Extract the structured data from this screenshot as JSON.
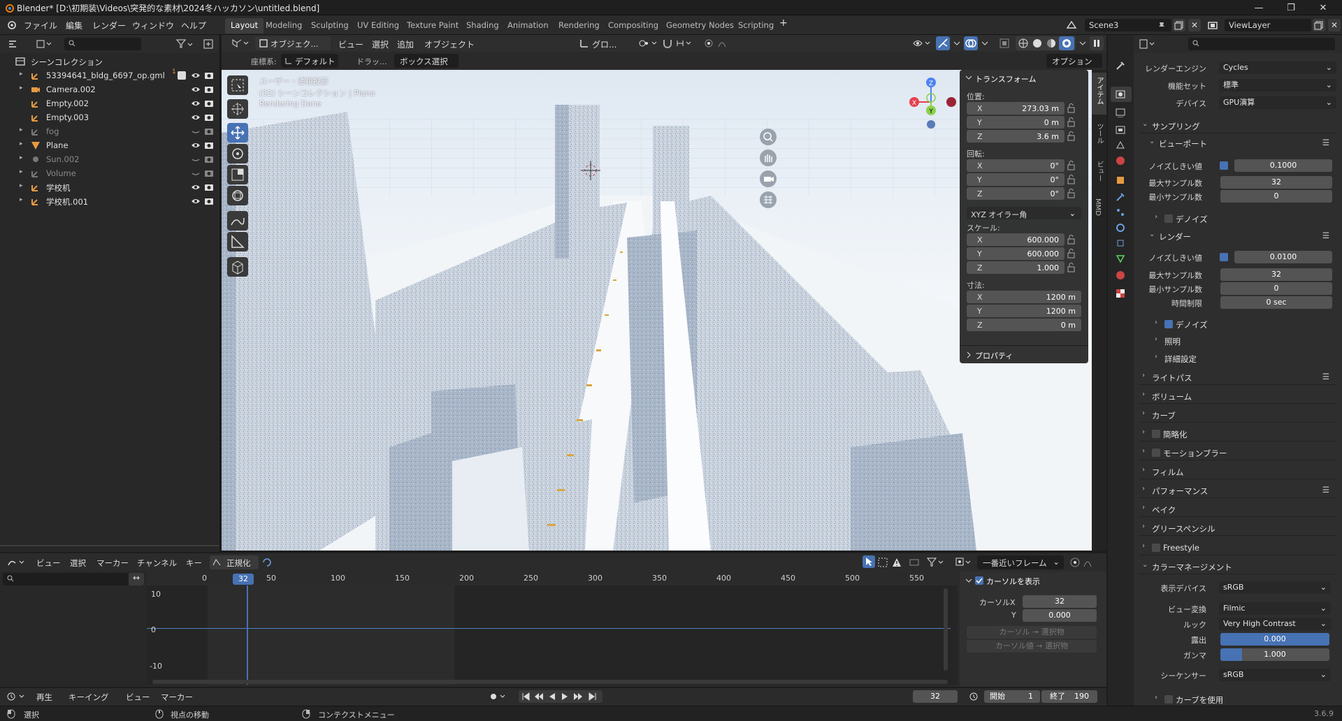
{
  "window": {
    "title": "Blender* [D:\\初期装\\Videos\\突発的な素材\\2024冬ハッカソン\\untitled.blend]"
  },
  "menu": [
    "ファイル",
    "編集",
    "レンダー",
    "ウィンドウ",
    "ヘルプ"
  ],
  "workspace_tabs": [
    {
      "label": "Layout",
      "active": true
    },
    {
      "label": "Modeling"
    },
    {
      "label": "Sculpting"
    },
    {
      "label": "UV Editing"
    },
    {
      "label": "Texture Paint"
    },
    {
      "label": "Shading"
    },
    {
      "label": "Animation"
    },
    {
      "label": "Rendering"
    },
    {
      "label": "Compositing"
    },
    {
      "label": "Geometry Nodes"
    },
    {
      "label": "Scripting"
    }
  ],
  "add_workspace": "+",
  "scene": "Scene3",
  "view_layer": "ViewLayer",
  "outliner": {
    "root": "シーンコレクション",
    "items": [
      {
        "label": "53394641_bldg_6697_op.gml",
        "badge": "1",
        "dim": false
      },
      {
        "label": "Camera.002",
        "dim": false
      },
      {
        "label": "Empty.002",
        "dim": false
      },
      {
        "label": "Empty.003",
        "dim": false
      },
      {
        "label": "fog",
        "dim": true
      },
      {
        "label": "Plane",
        "dim": false
      },
      {
        "label": "Sun.002",
        "dim": true
      },
      {
        "label": "Volume",
        "dim": true
      },
      {
        "label": "学校机",
        "dim": false
      },
      {
        "label": "学校机.001",
        "dim": false
      }
    ]
  },
  "viewport_header": {
    "mode": "オブジェク...",
    "menus": [
      "ビュー",
      "選択",
      "追加",
      "オブジェクト"
    ],
    "transform_orientation": "グロ...",
    "coord_label": "座標系:",
    "coord_value": "デフォルト",
    "drag_label": "ドラッ...",
    "select_mode": "ボックス選択",
    "options": "オプション"
  },
  "viewport_overlay": {
    "line1": "ユーザー・透視投影",
    "line2": "(32) シーンコレクション | Plane",
    "line3": "Rendering Done"
  },
  "gizmo": {
    "x": "X",
    "y": "Y",
    "z": "Z"
  },
  "npanel": {
    "transform_title": "トランスフォーム",
    "location_label": "位置:",
    "location": [
      {
        "k": "X",
        "v": "273.03 m"
      },
      {
        "k": "Y",
        "v": "0 m"
      },
      {
        "k": "Z",
        "v": "3.6 m"
      }
    ],
    "rotation_label": "回転:",
    "rotation": [
      {
        "k": "X",
        "v": "0°"
      },
      {
        "k": "Y",
        "v": "0°"
      },
      {
        "k": "Z",
        "v": "0°"
      }
    ],
    "rotation_mode": "XYZ オイラー角",
    "scale_label": "スケール:",
    "scale": [
      {
        "k": "X",
        "v": "600.000"
      },
      {
        "k": "Y",
        "v": "600.000"
      },
      {
        "k": "Z",
        "v": "1.000"
      }
    ],
    "dimensions_label": "寸法:",
    "dimensions": [
      {
        "k": "X",
        "v": "1200 m"
      },
      {
        "k": "Y",
        "v": "1200 m"
      },
      {
        "k": "Z",
        "v": "0 m"
      }
    ],
    "properties_title": "プロパティ",
    "side_tabs": [
      "アイテム",
      "ツール",
      "ビュー",
      "MMD"
    ]
  },
  "properties": {
    "render_engine_label": "レンダーエンジン",
    "render_engine": "Cycles",
    "feature_set_label": "機能セット",
    "feature_set": "標準",
    "device_label": "デバイス",
    "device": "GPU演算",
    "sampling": "サンプリング",
    "viewport": "ビューポート",
    "noise_threshold_label": "ノイズしきい値",
    "vp_noise": "0.1000",
    "max_samples_label": "最大サンプル数",
    "vp_max": "32",
    "min_samples_label": "最小サンプル数",
    "vp_min": "0",
    "denoise": "デノイズ",
    "render": "レンダー",
    "r_noise": "0.0100",
    "r_max": "32",
    "r_min": "0",
    "time_limit_label": "時間制限",
    "time_limit": "0 sec",
    "denoise2": "デノイズ",
    "lighting": "照明",
    "advanced": "詳細設定",
    "sections": [
      "ライトパス",
      "ボリューム",
      "カーブ",
      "簡略化",
      "モーションブラー",
      "フィルム",
      "パフォーマンス",
      "ベイク",
      "グリースペンシル",
      "Freestyle",
      "カラーマネージメント"
    ],
    "display_device_label": "表示デバイス",
    "display_device": "sRGB",
    "view_transform_label": "ビュー変換",
    "view_transform": "Filmic",
    "look_label": "ルック",
    "look": "Very High Contrast",
    "exposure_label": "露出",
    "exposure": "0.000",
    "gamma_label": "ガンマ",
    "gamma": "1.000",
    "gamma_value": 1.0,
    "sequencer_label": "シーケンサー",
    "sequencer": "sRGB",
    "use_curves": "カーブを使用"
  },
  "graph_editor": {
    "menus": [
      "ビュー",
      "選択",
      "マーカー",
      "チャンネル",
      "キー"
    ],
    "normalize": "正規化",
    "snap": "一番近いフレーム",
    "ticks": [
      "0",
      "50",
      "100",
      "150",
      "200",
      "250",
      "300",
      "350",
      "400",
      "450",
      "500",
      "550"
    ],
    "current_frame": "32",
    "y_labels": [
      "10",
      "0",
      "-10"
    ],
    "cursor_title": "カーソルを表示",
    "cursor_x_label": "カーソルX",
    "cursor_x": "32",
    "cursor_y_label": "Y",
    "cursor_y": "0.000",
    "btn1": "カーソル → 選択物",
    "btn2": "カーソル値 → 選択物"
  },
  "timeline": {
    "menus": [
      "再生",
      "キーイング",
      "ビュー",
      "マーカー"
    ],
    "frame": "32",
    "start_label": "開始",
    "start": "1",
    "end_label": "終了",
    "end": "190"
  },
  "status": {
    "select": "選択",
    "move": "視点の移動",
    "context": "コンテクストメニュー",
    "version": "3.6.9"
  },
  "colors": {
    "accent": "#4772b3",
    "object_orange": "#e69a42",
    "x_axis": "#e5404f",
    "y_axis": "#8bd14b",
    "z_axis": "#4c83f0"
  }
}
